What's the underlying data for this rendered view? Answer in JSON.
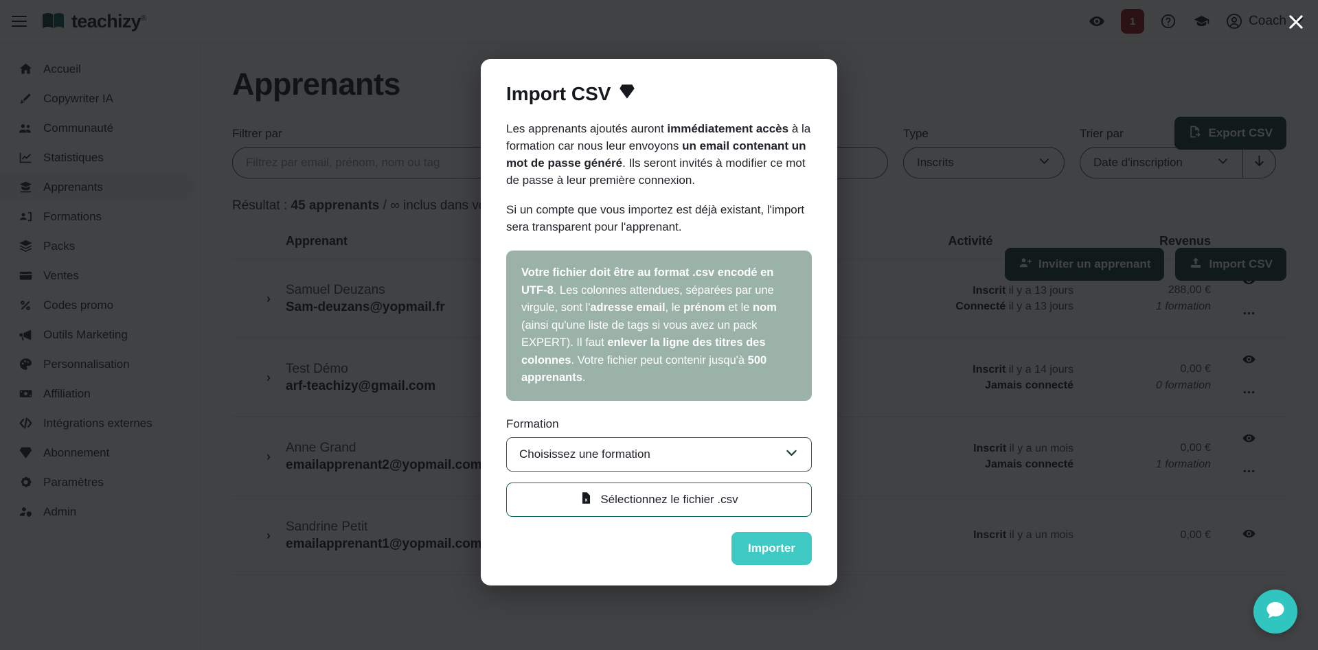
{
  "brand": {
    "name": "teachizy",
    "tm": "®"
  },
  "topbar": {
    "preview_icon": "eye-icon",
    "notification_count": "1",
    "help_icon": "question-circle-icon",
    "academy_icon": "graduation-cap-icon",
    "user_label": "Coach",
    "close_icon": "close-icon"
  },
  "sidebar": {
    "items": [
      {
        "label": "Accueil",
        "icon": "home-icon"
      },
      {
        "label": "Copywriter IA",
        "icon": "pen-icon"
      },
      {
        "label": "Communauté",
        "icon": "users-icon"
      },
      {
        "label": "Statistiques",
        "icon": "chart-line-icon"
      },
      {
        "label": "Apprenants",
        "icon": "student-icon",
        "active": true
      },
      {
        "label": "Formations",
        "icon": "presentation-icon"
      },
      {
        "label": "Packs",
        "icon": "layers-icon"
      },
      {
        "label": "Ventes",
        "icon": "wallet-icon"
      },
      {
        "label": "Codes promo",
        "icon": "percent-icon"
      },
      {
        "label": "Outils Marketing",
        "icon": "megaphone-icon"
      },
      {
        "label": "Personnalisation",
        "icon": "palette-icon"
      },
      {
        "label": "Affiliation",
        "icon": "banknote-icon"
      },
      {
        "label": "Intégrations externes",
        "icon": "code-icon"
      },
      {
        "label": "Abonnement",
        "icon": "diamond-icon"
      },
      {
        "label": "Paramètres",
        "icon": "gear-icon"
      },
      {
        "label": "Admin",
        "icon": "user-shield-icon"
      }
    ]
  },
  "main": {
    "page_title": "Apprenants",
    "export_button": "Export CSV",
    "invite_button": "Inviter un apprenant",
    "import_button": "Import CSV",
    "filters": {
      "filter_label": "Filtrer par",
      "filter_placeholder": "Filtrez par email, prénom, nom ou tag",
      "filter_value": "",
      "type_label": "Type",
      "type_value": "Inscrits",
      "sort_label": "Trier par",
      "sort_value": "Date d'inscription",
      "sort_direction_icon": "arrow-down-icon"
    },
    "result": {
      "prefix": "Résultat : ",
      "count": "45 apprenants",
      "suffix": " / ∞ inclus dans votre pack"
    },
    "table": {
      "columns": {
        "apprenant": "Apprenant",
        "activite": "Activité",
        "revenus": "Revenus"
      },
      "rows": [
        {
          "name": "Samuel Deuzans",
          "email": "Sam-deuzans@yopmail.fr",
          "activity_1_label": "Inscrit",
          "activity_1_value": " il y a 13 jours",
          "activity_2_label": "Connecté",
          "activity_2_value": " il y a 13 jours",
          "revenue": "288,00 €",
          "formations": "1 formation"
        },
        {
          "name": "Test Démo",
          "email": "arf-teachizy@gmail.com",
          "activity_1_label": "Inscrit",
          "activity_1_value": " il y a 14 jours",
          "activity_2_label": "Jamais connecté",
          "activity_2_value": "",
          "revenue": "0,00 €",
          "formations": "0 formation"
        },
        {
          "name": "Anne Grand",
          "email": "emailapprenant2@yopmail.com",
          "activity_1_label": "Inscrit",
          "activity_1_value": " il y a un mois",
          "activity_2_label": "Jamais connecté",
          "activity_2_value": "",
          "revenue": "0,00 €",
          "formations": "1 formation"
        },
        {
          "name": "Sandrine Petit",
          "email": "emailapprenant1@yopmail.com",
          "activity_1_label": "Inscrit",
          "activity_1_value": " il y a un mois",
          "activity_2_label": "",
          "activity_2_value": "",
          "revenue": "0,00 €",
          "formations": ""
        }
      ],
      "row_chevron_icon": "chevron-right-icon",
      "row_view_icon": "eye-icon",
      "row_more_icon": "more-horizontal-icon"
    },
    "chat_icon": "chat-bubble-icon"
  },
  "modal": {
    "title": "Import CSV",
    "title_icon": "diamond-icon",
    "paragraph_1": {
      "t1": "Les apprenants ajoutés auront ",
      "b1": "immédiatement accès",
      "t2": " à la formation car nous leur envoyons ",
      "b2": "un email contenant un mot de passe généré",
      "t3": ". Ils seront invités à modifier ce mot de passe à leur première connexion."
    },
    "paragraph_2": "Si un compte que vous importez est déjà existant, l'import sera transparent pour l'apprenant.",
    "info_box": {
      "b1": "Votre fichier doit être au format .csv encodé en UTF-8",
      "t1": ". Les colonnes attendues, séparées par une virgule, sont l'",
      "b2": "adresse email",
      "t2": ", le ",
      "b3": "prénom",
      "t3": " et le ",
      "b4": "nom",
      "t4": " (ainsi qu'une liste de tags si vous avez un pack EXPERT). Il faut ",
      "b5": "enlever la ligne des titres des colonnes",
      "t5": ". Votre fichier peut contenir jusqu'à ",
      "b6": "500 apprenants",
      "t6": "."
    },
    "formation_label": "Formation",
    "formation_value": "Choisissez une formation",
    "file_button": "Sélectionnez le fichier .csv",
    "file_icon": "csv-file-icon",
    "submit_button": "Importer"
  },
  "colors": {
    "brand_dark": "#0d3b35",
    "accent_teal": "#3ec9c4",
    "info_green": "#9bb2a8",
    "badge_red": "#8b1114"
  }
}
